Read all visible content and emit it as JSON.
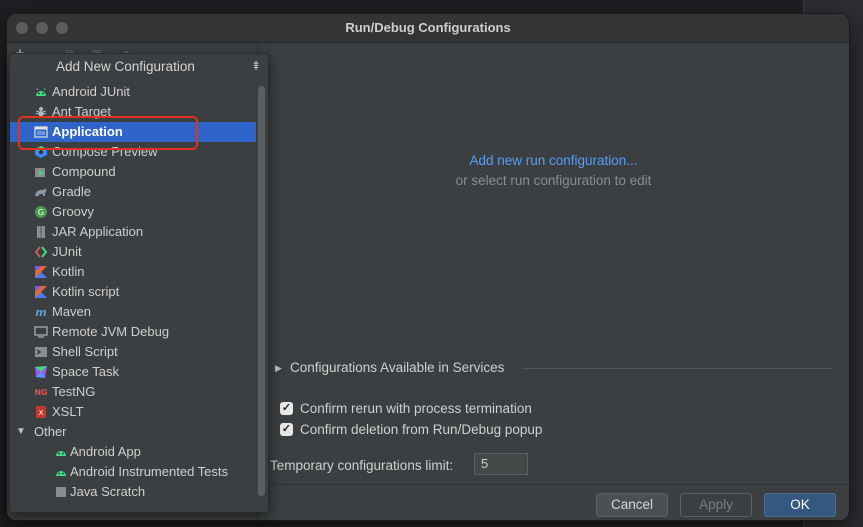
{
  "window": {
    "title": "Run/Debug Configurations"
  },
  "toolbar": {
    "add": "+",
    "remove": "−",
    "copy": "⧉",
    "folder": "▣",
    "sort": "↓z"
  },
  "popup": {
    "title": "Add New Configuration",
    "items": [
      {
        "label": "Android JUnit",
        "icon": "android-icon"
      },
      {
        "label": "Ant Target",
        "icon": "ant-icon"
      },
      {
        "label": "Application",
        "icon": "application-icon",
        "selected": true
      },
      {
        "label": "Compose Preview",
        "icon": "compose-icon"
      },
      {
        "label": "Compound",
        "icon": "compound-icon"
      },
      {
        "label": "Gradle",
        "icon": "gradle-icon"
      },
      {
        "label": "Groovy",
        "icon": "groovy-icon"
      },
      {
        "label": "JAR Application",
        "icon": "jar-icon"
      },
      {
        "label": "JUnit",
        "icon": "junit-icon"
      },
      {
        "label": "Kotlin",
        "icon": "kotlin-icon"
      },
      {
        "label": "Kotlin script",
        "icon": "kotlin-script-icon"
      },
      {
        "label": "Maven",
        "icon": "maven-icon"
      },
      {
        "label": "Remote JVM Debug",
        "icon": "remote-debug-icon"
      },
      {
        "label": "Shell Script",
        "icon": "shell-icon"
      },
      {
        "label": "Space Task",
        "icon": "space-icon"
      },
      {
        "label": "TestNG",
        "icon": "testng-icon"
      },
      {
        "label": "XSLT",
        "icon": "xslt-icon"
      }
    ],
    "group": {
      "label": "Other"
    },
    "sub_items": [
      {
        "label": "Android App",
        "icon": "android-icon"
      },
      {
        "label": "Android Instrumented Tests",
        "icon": "android-icon"
      },
      {
        "label": "Java Scratch",
        "icon": "java-icon"
      }
    ]
  },
  "main": {
    "add_link": "Add new run configuration...",
    "or_select": "or select run configuration to edit",
    "services_label": "Configurations Available in Services",
    "confirm_rerun": "Confirm rerun with process termination",
    "confirm_deletion": "Confirm deletion from Run/Debug popup",
    "limit_label": "Temporary configurations limit:",
    "limit_value": "5"
  },
  "buttons": {
    "cancel": "Cancel",
    "apply": "Apply",
    "ok": "OK"
  },
  "colors": {
    "accent": "#589df6",
    "selection": "#2f65ca",
    "highlight_box": "#e0321e",
    "ok_button": "#365880"
  }
}
